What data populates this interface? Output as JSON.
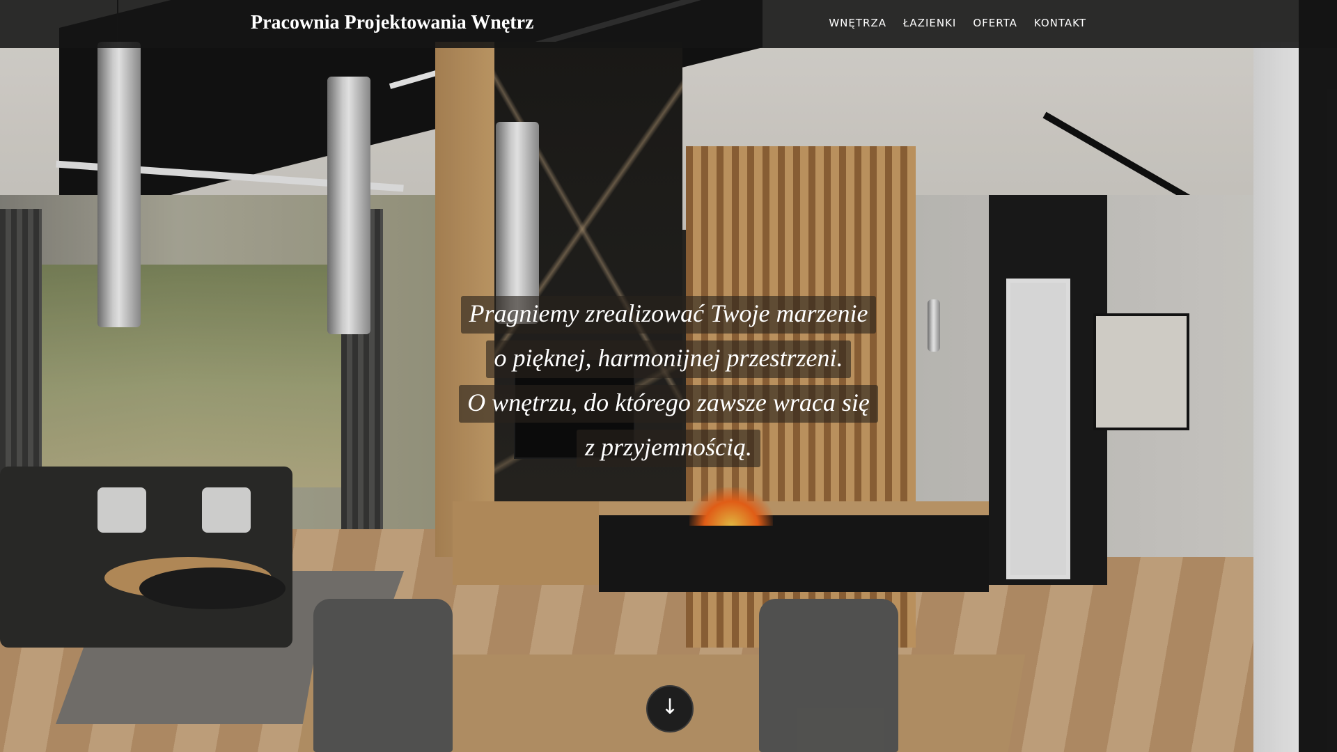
{
  "header": {
    "brand": "Pracownia Projektowania Wnętrz",
    "nav": [
      {
        "label": "WNĘTRZA"
      },
      {
        "label": "ŁAZIENKI"
      },
      {
        "label": "OFERTA"
      },
      {
        "label": "KONTAKT"
      }
    ]
  },
  "hero": {
    "lines": [
      "Pragniemy zrealizować Twoje marzenie",
      "o pięknej, harmonijnej przestrzeni.",
      "O wnętrzu, do którego zawsze wraca się",
      "z przyjemnością."
    ],
    "scroll_icon": "arrow-down-icon",
    "scroll_glyph": "↓"
  },
  "colors": {
    "header_bg": "#141414",
    "text": "#ffffff",
    "quote_bg": "#28221c"
  }
}
